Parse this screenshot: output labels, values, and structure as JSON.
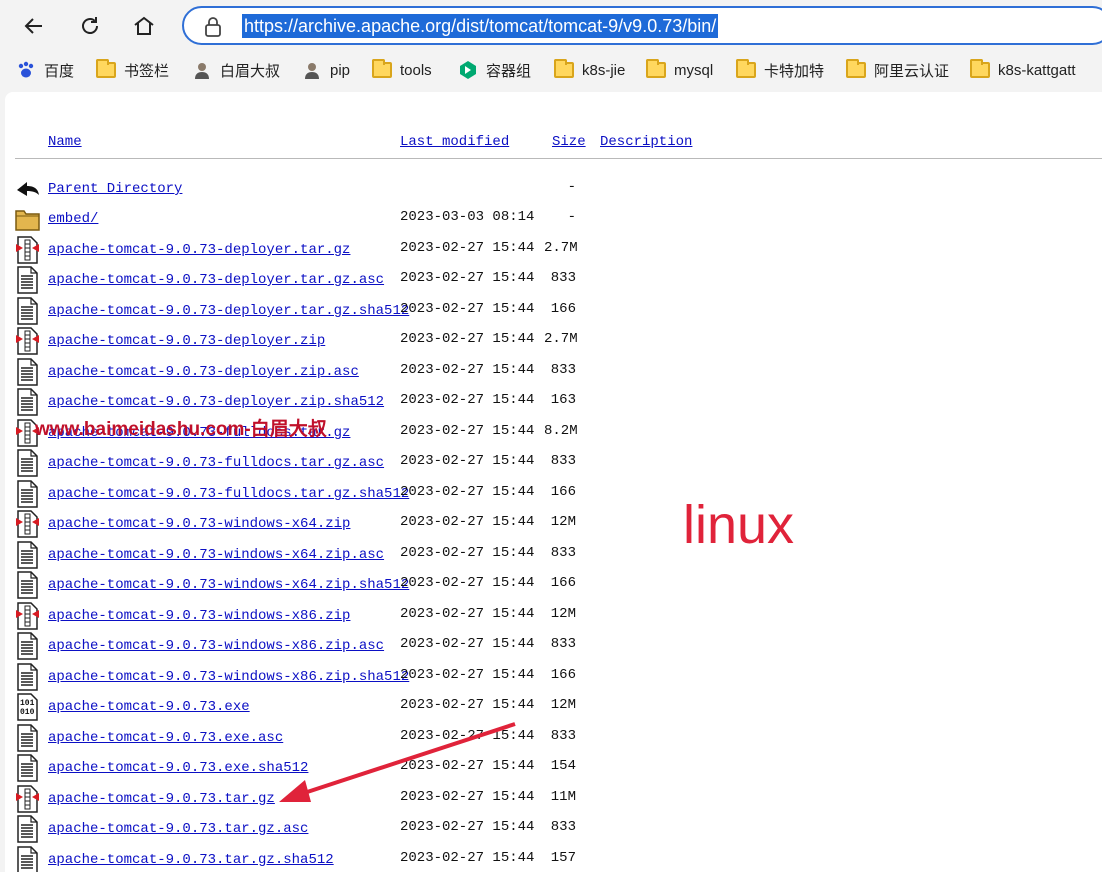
{
  "browser": {
    "url": "https://archive.apache.org/dist/tomcat/tomcat-9/v9.0.73/bin/",
    "bookmarks": [
      {
        "label": "百度",
        "icon": "paw-icon"
      },
      {
        "label": "书签栏",
        "icon": "folder-icon"
      },
      {
        "label": "白眉大叔",
        "icon": "avatar-icon"
      },
      {
        "label": "pip",
        "icon": "avatar-icon"
      },
      {
        "label": "tools",
        "icon": "folder-icon"
      },
      {
        "label": "容器组",
        "icon": "kubesphere-icon"
      },
      {
        "label": "k8s-jie",
        "icon": "folder-icon"
      },
      {
        "label": "mysql",
        "icon": "folder-icon"
      },
      {
        "label": "卡特加特",
        "icon": "folder-icon"
      },
      {
        "label": "阿里云认证",
        "icon": "folder-icon"
      },
      {
        "label": "k8s-kattgatt",
        "icon": "folder-icon"
      }
    ]
  },
  "listing": {
    "headers": {
      "name": "Name",
      "modified": "Last modified",
      "size": "Size",
      "description": "Description"
    },
    "rows": [
      {
        "name": "Parent Directory",
        "date": "",
        "size": "-",
        "icon": "back-icon"
      },
      {
        "name": "embed/",
        "date": "2023-03-03 08:14",
        "size": "-",
        "icon": "folder-icon"
      },
      {
        "name": "apache-tomcat-9.0.73-deployer.tar.gz",
        "date": "2023-02-27 15:44",
        "size": "2.7M",
        "icon": "compressed-icon"
      },
      {
        "name": "apache-tomcat-9.0.73-deployer.tar.gz.asc",
        "date": "2023-02-27 15:44",
        "size": "833",
        "icon": "text-file-icon"
      },
      {
        "name": "apache-tomcat-9.0.73-deployer.tar.gz.sha512",
        "date": "2023-02-27 15:44",
        "size": "166",
        "icon": "text-file-icon"
      },
      {
        "name": "apache-tomcat-9.0.73-deployer.zip",
        "date": "2023-02-27 15:44",
        "size": "2.7M",
        "icon": "compressed-icon"
      },
      {
        "name": "apache-tomcat-9.0.73-deployer.zip.asc",
        "date": "2023-02-27 15:44",
        "size": "833",
        "icon": "text-file-icon"
      },
      {
        "name": "apache-tomcat-9.0.73-deployer.zip.sha512",
        "date": "2023-02-27 15:44",
        "size": "163",
        "icon": "text-file-icon"
      },
      {
        "name": "apache-tomcat-9.0.73-fulldocs.tar.gz",
        "date": "2023-02-27 15:44",
        "size": "8.2M",
        "icon": "compressed-icon"
      },
      {
        "name": "apache-tomcat-9.0.73-fulldocs.tar.gz.asc",
        "date": "2023-02-27 15:44",
        "size": "833",
        "icon": "text-file-icon"
      },
      {
        "name": "apache-tomcat-9.0.73-fulldocs.tar.gz.sha512",
        "date": "2023-02-27 15:44",
        "size": "166",
        "icon": "text-file-icon"
      },
      {
        "name": "apache-tomcat-9.0.73-windows-x64.zip",
        "date": "2023-02-27 15:44",
        "size": "12M",
        "icon": "compressed-icon"
      },
      {
        "name": "apache-tomcat-9.0.73-windows-x64.zip.asc",
        "date": "2023-02-27 15:44",
        "size": "833",
        "icon": "text-file-icon"
      },
      {
        "name": "apache-tomcat-9.0.73-windows-x64.zip.sha512",
        "date": "2023-02-27 15:44",
        "size": "166",
        "icon": "text-file-icon"
      },
      {
        "name": "apache-tomcat-9.0.73-windows-x86.zip",
        "date": "2023-02-27 15:44",
        "size": "12M",
        "icon": "compressed-icon"
      },
      {
        "name": "apache-tomcat-9.0.73-windows-x86.zip.asc",
        "date": "2023-02-27 15:44",
        "size": "833",
        "icon": "text-file-icon"
      },
      {
        "name": "apache-tomcat-9.0.73-windows-x86.zip.sha512",
        "date": "2023-02-27 15:44",
        "size": "166",
        "icon": "text-file-icon"
      },
      {
        "name": "apache-tomcat-9.0.73.exe",
        "date": "2023-02-27 15:44",
        "size": "12M",
        "icon": "binary-icon"
      },
      {
        "name": "apache-tomcat-9.0.73.exe.asc",
        "date": "2023-02-27 15:44",
        "size": "833",
        "icon": "text-file-icon"
      },
      {
        "name": "apache-tomcat-9.0.73.exe.sha512",
        "date": "2023-02-27 15:44",
        "size": "154",
        "icon": "text-file-icon"
      },
      {
        "name": "apache-tomcat-9.0.73.tar.gz",
        "date": "2023-02-27 15:44",
        "size": "11M",
        "icon": "compressed-icon"
      },
      {
        "name": "apache-tomcat-9.0.73.tar.gz.asc",
        "date": "2023-02-27 15:44",
        "size": "833",
        "icon": "text-file-icon"
      },
      {
        "name": "apache-tomcat-9.0.73.tar.gz.sha512",
        "date": "2023-02-27 15:44",
        "size": "157",
        "icon": "text-file-icon"
      }
    ]
  },
  "annotations": {
    "watermark": "www.baimeidashu.com-白眉大叔",
    "note": "linux",
    "accent": "#e0233a"
  }
}
